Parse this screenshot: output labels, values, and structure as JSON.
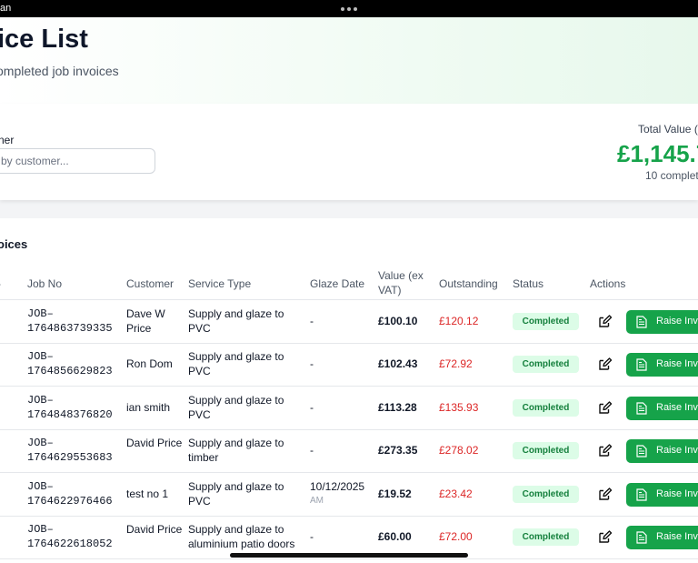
{
  "status_bar": {
    "left_text": "an"
  },
  "header": {
    "title": "ice List",
    "subtitle": "ompleted job invoices"
  },
  "filter": {
    "label": "ner",
    "search_placeholder": "by customer...",
    "total_label": "Total Value (",
    "total_value": "£1,145.7",
    "total_count": "10 complet"
  },
  "table": {
    "section_title": "oices",
    "columns": {
      "dash": "-",
      "job_no": "Job No",
      "customer": "Customer",
      "service_type": "Service Type",
      "glaze_date": "Glaze Date",
      "value": "Value (ex VAT)",
      "outstanding": "Outstanding",
      "status": "Status",
      "actions": "Actions"
    },
    "action_label": "Raise Invo",
    "rows": [
      {
        "job_no": "JOB–1764863739335",
        "customer": "Dave W Price",
        "service_type": "Supply and glaze to PVC",
        "glaze_date": "-",
        "glaze_time": "",
        "value": "£100.10",
        "outstanding": "£120.12",
        "status": "Completed"
      },
      {
        "job_no": "JOB–1764856629823",
        "customer": "Ron Dom",
        "service_type": "Supply and glaze to PVC",
        "glaze_date": "-",
        "glaze_time": "",
        "value": "£102.43",
        "outstanding": "£72.92",
        "status": "Completed"
      },
      {
        "job_no": "JOB–1764848376820",
        "customer": "ian smith",
        "service_type": "Supply and glaze to PVC",
        "glaze_date": "-",
        "glaze_time": "",
        "value": "£113.28",
        "outstanding": "£135.93",
        "status": "Completed"
      },
      {
        "job_no": "JOB–1764629553683",
        "customer": "David Price",
        "service_type": "Supply and glaze to timber",
        "glaze_date": "-",
        "glaze_time": "",
        "value": "£273.35",
        "outstanding": "£278.02",
        "status": "Completed"
      },
      {
        "job_no": "JOB–1764622976466",
        "customer": "test no 1",
        "service_type": "Supply and glaze to PVC",
        "glaze_date": "10/12/2025",
        "glaze_time": "AM",
        "value": "£19.52",
        "outstanding": "£23.42",
        "status": "Completed"
      },
      {
        "job_no": "JOB–1764622618052",
        "customer": "David Price",
        "service_type": "Supply and glaze to aluminium patio doors",
        "glaze_date": "-",
        "glaze_time": "",
        "value": "£60.00",
        "outstanding": "£72.00",
        "status": "Completed"
      }
    ]
  },
  "colors": {
    "accent_green": "#16a34a",
    "status_badge_bg": "#dcfce7",
    "outstanding_red": "#dc2626"
  },
  "icons": [
    "edit-icon",
    "document-icon"
  ]
}
